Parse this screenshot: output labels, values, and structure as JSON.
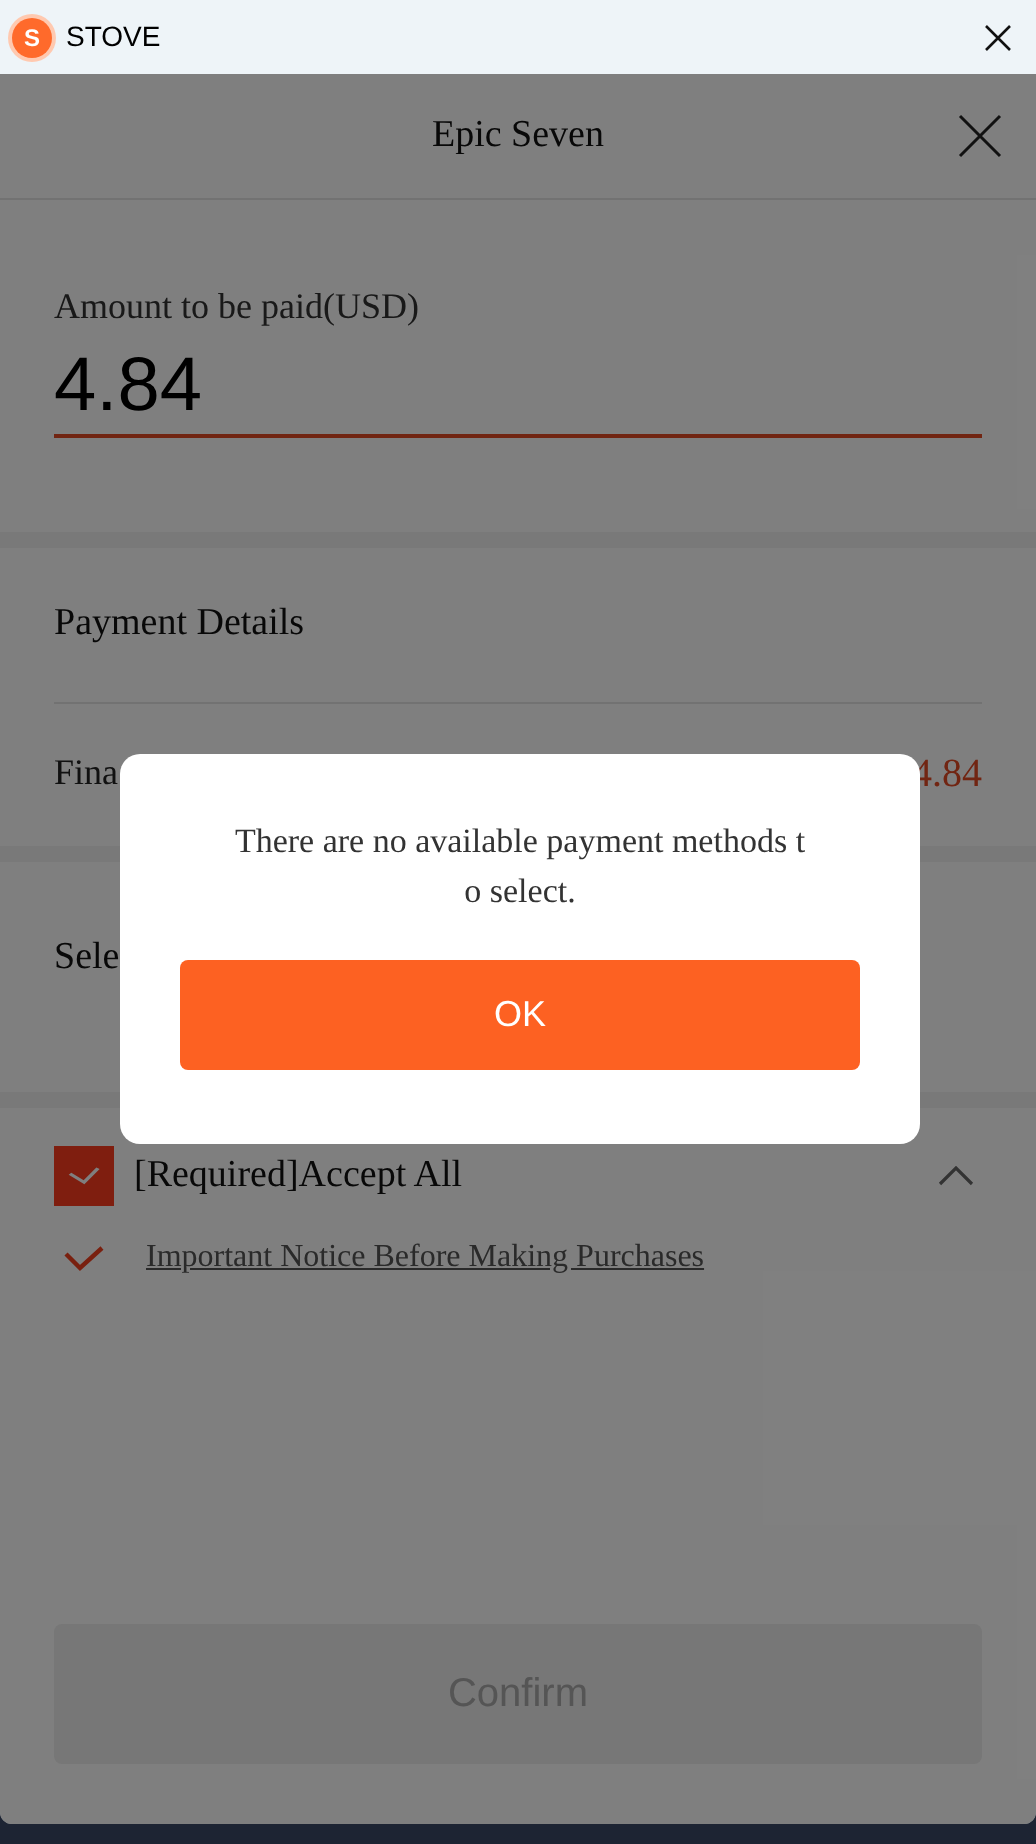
{
  "titlebar": {
    "logo_letter": "S",
    "title": "STOVE"
  },
  "header": {
    "title": "Epic Seven"
  },
  "amount": {
    "label": "Amount to be paid(USD)",
    "value": "4.84"
  },
  "payment_details": {
    "title": "Payment Details",
    "final_label": "Fina",
    "final_value": "4.84"
  },
  "select_section": {
    "title": "Sele"
  },
  "agreements": {
    "accept_all": {
      "label": "[Required]Accept All",
      "checked": true,
      "expanded": true
    },
    "items": [
      {
        "label": "Important Notice Before Making Purchases",
        "checked": true
      }
    ]
  },
  "confirm_button": {
    "label": "Confirm",
    "disabled": true
  },
  "dialog": {
    "message": "There are no available payment methods to select.",
    "button": "OK"
  }
}
